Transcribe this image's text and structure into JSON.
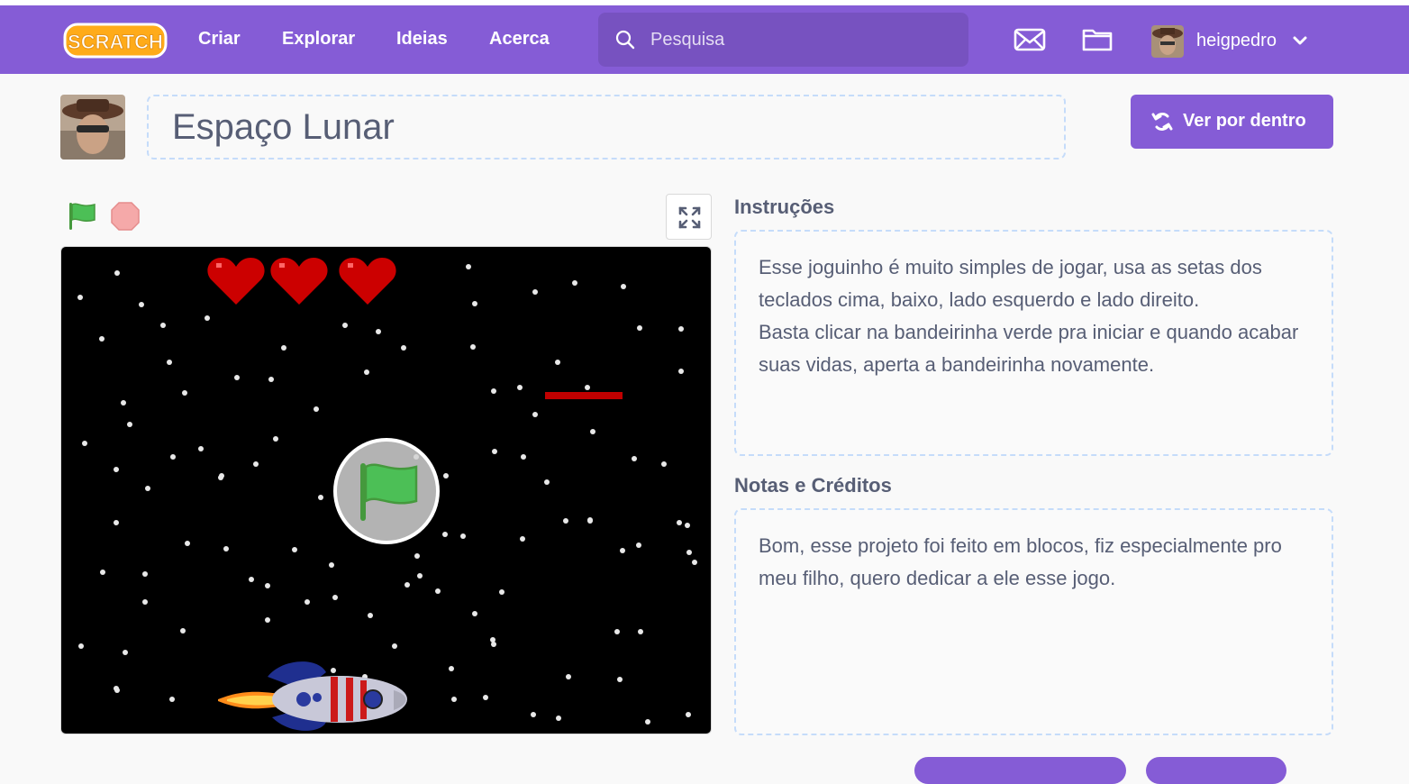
{
  "navbar": {
    "logo_text": "SCRATCH",
    "links": [
      "Criar",
      "Explorar",
      "Ideias",
      "Acerca"
    ],
    "search_placeholder": "Pesquisa",
    "username": "heigpedro",
    "icons": [
      "messages-icon",
      "my-stuff-folder-icon",
      "chevron-down-icon"
    ]
  },
  "project": {
    "title": "Espaço Lunar",
    "see_inside_label": "Ver por dentro"
  },
  "player": {
    "controls": [
      "green-flag-icon",
      "stop-icon",
      "fullscreen-icon"
    ],
    "lives": 3
  },
  "instructions": {
    "heading": "Instruções",
    "text": "Esse joguinho é muito simples de jogar, usa as setas dos teclados cima, baixo, lado esquerdo e lado direito.\nBasta clicar na bandeirinha verde pra iniciar e quando acabar suas vidas, aperta a bandeirinha novamente."
  },
  "notes": {
    "heading": "Notas e Créditos",
    "text": "Bom, esse projeto foi feito em blocos, fiz especialmente pro meu filho, quero dedicar a ele esse jogo."
  },
  "colors": {
    "brand": "#855cd6",
    "text": "#575e75",
    "heart": "#cc0000",
    "flag_green": "#4cbf56"
  }
}
